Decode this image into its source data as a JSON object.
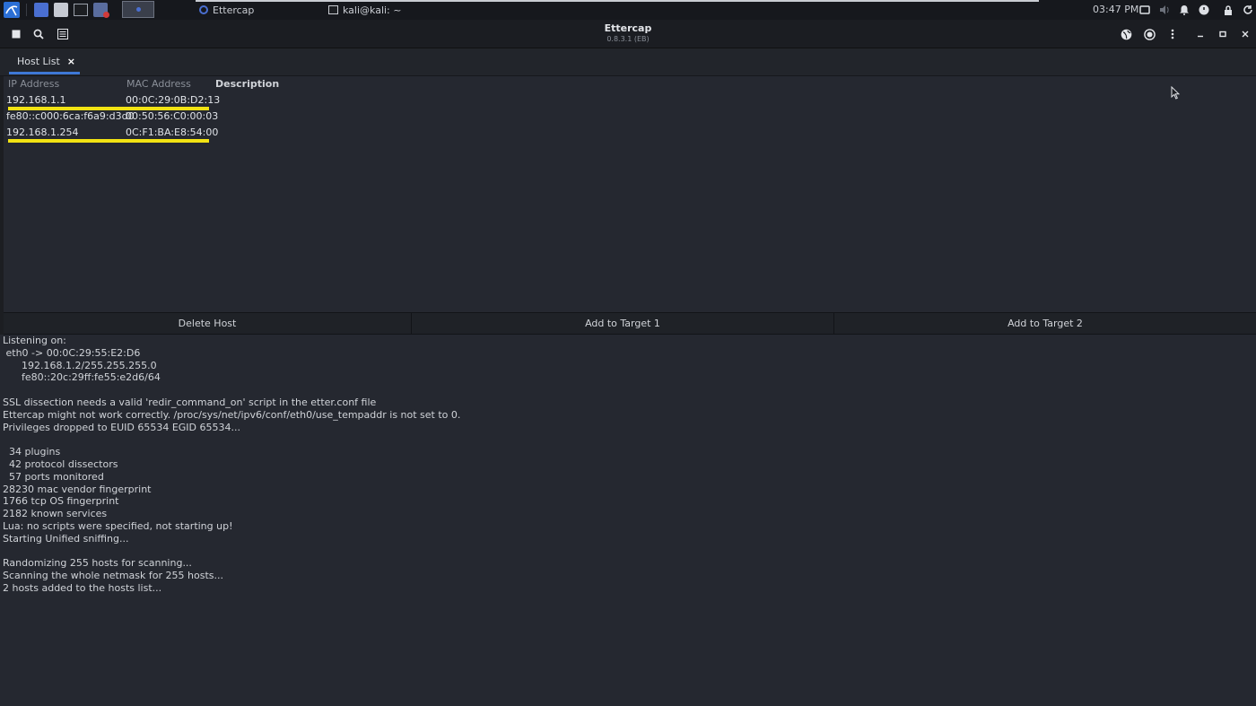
{
  "taskbar": {
    "tasks": [
      {
        "label": "Ettercap"
      },
      {
        "label": "kali@kali: ~"
      }
    ],
    "clock": "03:47 PM",
    "icons": [
      "kali-menu-icon",
      "file-manager-icon",
      "folder-icon",
      "terminal-icon",
      "media-icon",
      "workspace-icon",
      "display-icon",
      "volume-icon",
      "bell-icon",
      "power-icon",
      "lock-icon",
      "refresh-icon"
    ]
  },
  "window": {
    "title": "Ettercap",
    "version": "0.8.3.1 (EB)",
    "toolbar_icons": [
      "stop-icon",
      "search-icon",
      "host-list-icon",
      "mitm-globe-icon",
      "record-icon",
      "menu-kebab-icon",
      "minimize-icon",
      "maximize-icon",
      "close-icon"
    ]
  },
  "tabs": [
    {
      "label": "Host List",
      "close": "×",
      "active": true
    }
  ],
  "hostlist": {
    "columns": [
      "IP Address",
      "MAC Address",
      "Description"
    ],
    "rows": [
      {
        "ip": "192.168.1.1",
        "mac": "00:0C:29:0B:D2:13",
        "highlighted": true
      },
      {
        "ip": "fe80::c000:6ca:f6a9:d3d0",
        "mac": "00:50:56:C0:00:03",
        "highlighted": false
      },
      {
        "ip": "192.168.1.254",
        "mac": "0C:F1:BA:E8:54:00",
        "highlighted": true
      }
    ],
    "highlight_color": "#f2e313"
  },
  "actions": {
    "delete_host": "Delete Host",
    "add_target_1": "Add to Target 1",
    "add_target_2": "Add to Target 2"
  },
  "log": [
    "Listening on:",
    " eth0 -> 00:0C:29:55:E2:D6",
    "      192.168.1.2/255.255.255.0",
    "      fe80::20c:29ff:fe55:e2d6/64",
    "",
    "SSL dissection needs a valid 'redir_command_on' script in the etter.conf file",
    "Ettercap might not work correctly. /proc/sys/net/ipv6/conf/eth0/use_tempaddr is not set to 0.",
    "Privileges dropped to EUID 65534 EGID 65534...",
    "",
    "  34 plugins",
    "  42 protocol dissectors",
    "  57 ports monitored",
    "28230 mac vendor fingerprint",
    "1766 tcp OS fingerprint",
    "2182 known services",
    "Lua: no scripts were specified, not starting up!",
    "Starting Unified sniffing...",
    "",
    "Randomizing 255 hosts for scanning...",
    "Scanning the whole netmask for 255 hosts...",
    "2 hosts added to the hosts list..."
  ],
  "colors": {
    "background": "#252830",
    "titlebar": "#1b1d22",
    "accent": "#3e78d6"
  }
}
